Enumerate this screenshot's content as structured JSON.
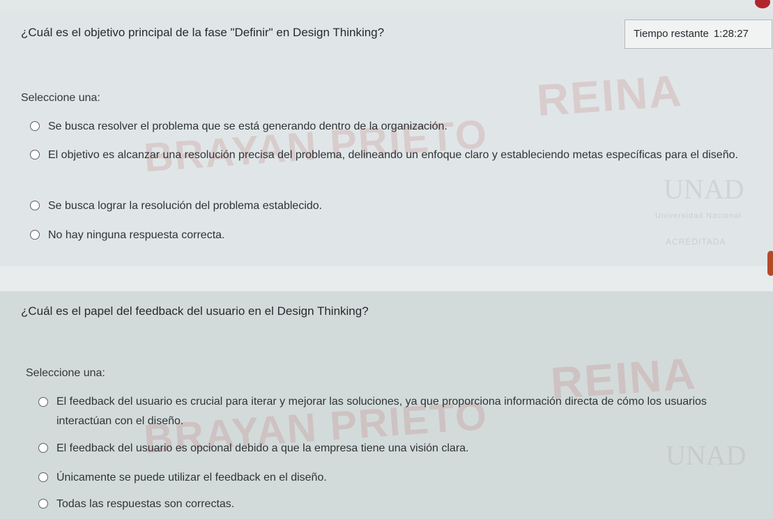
{
  "timer": {
    "label": "Tiempo restante",
    "value": "1:28:27"
  },
  "questions": [
    {
      "text": "¿Cuál es el objetivo principal de la fase \"Definir\" en Design Thinking?",
      "select_label": "Seleccione una:",
      "options": [
        "Se busca resolver el problema que se está generando dentro de la organización.",
        "El objetivo es alcanzar una resolución precisa del problema, delineando un enfoque claro y estableciendo metas específicas para el diseño.",
        "Se busca lograr la resolución del problema establecido.",
        "No hay ninguna respuesta correcta."
      ]
    },
    {
      "text": "¿Cuál es el papel del feedback del usuario en el Design Thinking?",
      "select_label": "Seleccione una:",
      "options": [
        "El feedback del usuario es crucial para iterar y mejorar las soluciones, ya que proporciona información directa de cómo los usuarios interactúan con el diseño.",
        "El feedback del usuario es opcional debido a que la empresa tiene una visión clara.",
        "Únicamente se puede utilizar el feedback en el diseño.",
        "Todas las respuestas son correctas."
      ]
    }
  ],
  "watermark": {
    "text_top": "REINA",
    "text_bottom": "BRAYAN PRIETO",
    "logo": "UNAD",
    "caption": "Universidad Nacional",
    "badge": "ACREDITADA"
  }
}
